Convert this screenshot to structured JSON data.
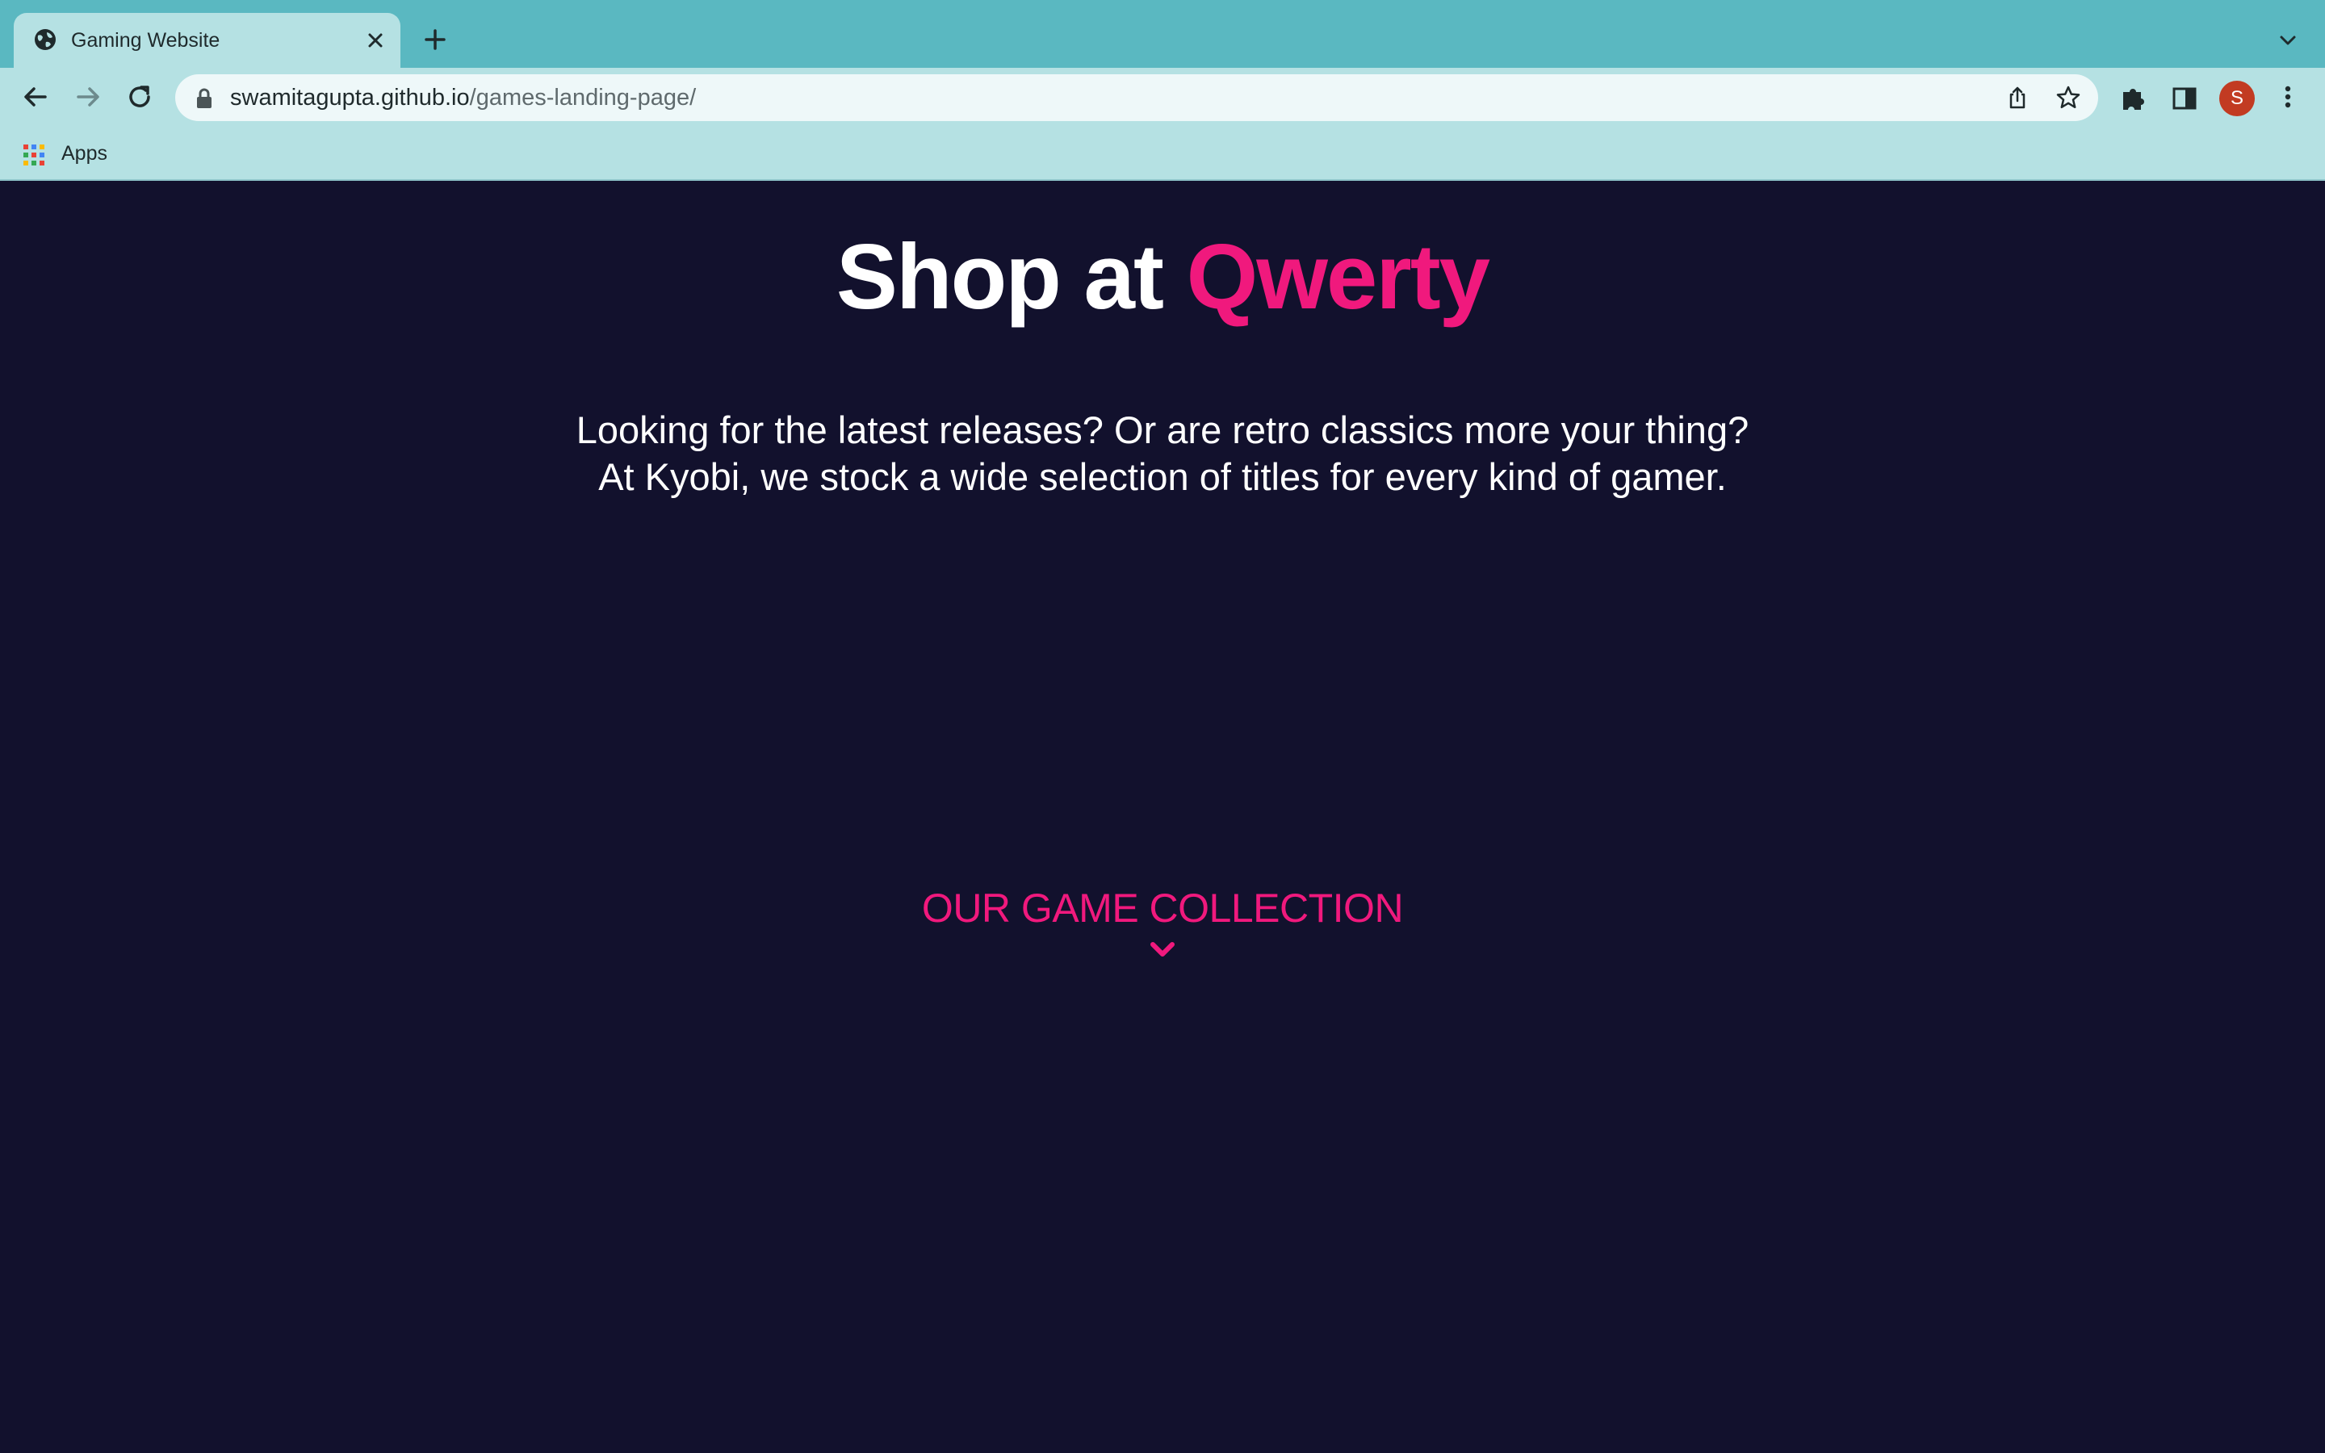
{
  "browser": {
    "tab": {
      "title": "Gaming Website"
    },
    "omnibox": {
      "host": "swamitagupta.github.io",
      "path": "/games-landing-page/"
    },
    "profile": {
      "initial": "S"
    },
    "bookmarks": {
      "apps_label": "Apps"
    },
    "icons": {
      "tab_favicon": "globe-icon",
      "tab_close": "close-icon",
      "new_tab": "plus-icon",
      "tab_search": "chevron-down-icon",
      "back": "arrow-left-icon",
      "forward": "arrow-right-icon",
      "reload": "reload-icon",
      "lock": "lock-icon",
      "share": "share-icon",
      "bookmark": "star-icon",
      "extensions": "puzzle-icon",
      "side_panel": "side-panel-icon",
      "menu": "kebab-menu-icon",
      "apps": "apps-grid-icon"
    },
    "colors": {
      "tabstrip": "#5ab8c1",
      "toolbar": "#b5e1e3",
      "avatar": "#c23b22"
    }
  },
  "page": {
    "hero": {
      "title_prefix": "Shop at ",
      "title_brand": "Qwerty",
      "subtitle_line1": "Looking for the latest releases? Or are retro classics more your thing?",
      "subtitle_line2": "At Kyobi, we stock a wide selection of titles for every kind of gamer."
    },
    "collection": {
      "label": "OUR GAME COLLECTION",
      "icon": "chevron-down-icon"
    },
    "colors": {
      "background": "#12112d",
      "accent": "#f0197d",
      "text": "#ffffff"
    }
  }
}
